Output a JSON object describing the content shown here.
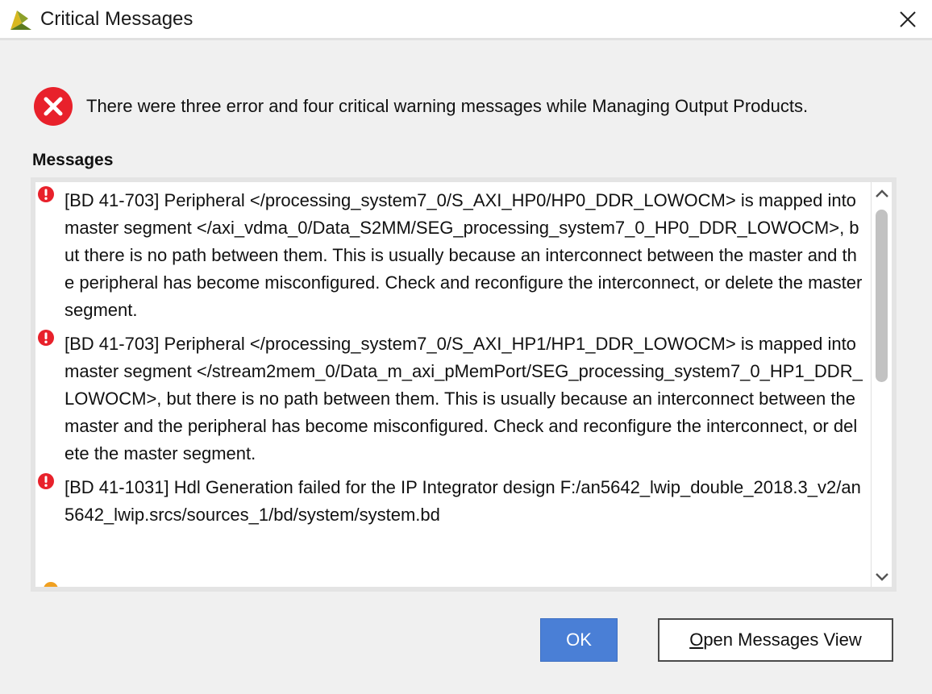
{
  "window": {
    "title": "Critical Messages",
    "app_icon": "vivado-logo-icon",
    "close_icon": "close-icon"
  },
  "summary": {
    "icon": "error-circle-icon",
    "text": "There were three error and four critical warning messages while Managing Output Products."
  },
  "messages_label": "Messages",
  "messages": [
    {
      "severity": "error",
      "icon": "error-icon",
      "text": "[BD 41-703] Peripheral </processing_system7_0/S_AXI_HP0/HP0_DDR_LOWOCM> is mapped into master segment </axi_vdma_0/Data_S2MM/SEG_processing_system7_0_HP0_DDR_LOWOCM>, but there is no path between them. This is usually because an interconnect between the master and the peripheral has become misconfigured. Check and reconfigure the interconnect, or delete the master segment."
    },
    {
      "severity": "error",
      "icon": "error-icon",
      "text": "[BD 41-703] Peripheral </processing_system7_0/S_AXI_HP1/HP1_DDR_LOWOCM> is mapped into master segment </stream2mem_0/Data_m_axi_pMemPort/SEG_processing_system7_0_HP1_DDR_LOWOCM>, but there is no path between them. This is usually because an interconnect between the master and the peripheral has become misconfigured. Check and reconfigure the interconnect, or delete the master segment."
    },
    {
      "severity": "error",
      "icon": "error-icon",
      "text": "[BD 41-1031] Hdl Generation failed for the IP Integrator design F:/an5642_lwip_double_2018.3_v2/an5642_lwip.srcs/sources_1/bd/system/system.bd"
    }
  ],
  "buttons": {
    "ok_label": "OK",
    "open_view_mnemonic": "O",
    "open_view_rest": "pen Messages View"
  },
  "colors": {
    "accent": "#4a7fd6",
    "error": "#e8212b",
    "warning": "#f0a020"
  }
}
